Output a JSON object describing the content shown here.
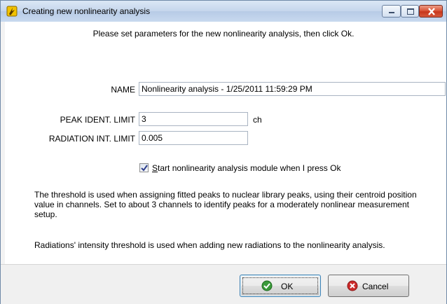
{
  "window": {
    "title": "Creating new nonlinearity analysis",
    "icon": "lightning-wrench-icon",
    "controls": {
      "minimize": "minimize-icon",
      "maximize": "maximize-icon",
      "close": "close-icon"
    }
  },
  "instructions": "Please set parameters for the new nonlinearity analysis, then click Ok.",
  "fields": {
    "name": {
      "label": "NAME",
      "value": "Nonlinearity analysis - 1/25/2011 11:59:29 PM"
    },
    "peak_ident_limit": {
      "label": "PEAK IDENT. LIMIT",
      "value": "3",
      "unit": "ch"
    },
    "radiation_int_limit": {
      "label": "RADIATION INT. LIMIT",
      "value": "0.005"
    }
  },
  "checkbox": {
    "label_prefix": "S",
    "label_rest": "tart nonlinearity analysis module when I press Ok",
    "checked": true
  },
  "help": {
    "threshold": "The threshold is used when assigning fitted peaks to nuclear library peaks, using their centroid position value in channels. Set to about 3 channels to identify peaks for a moderately nonlinear measurement setup.",
    "radiation": "Radiations' intensity threshold is used when adding new radiations to the nonlinearity analysis."
  },
  "buttons": {
    "ok": "OK",
    "cancel": "Cancel"
  },
  "colors": {
    "titlebar": "#c5d6ec",
    "close": "#c7371c",
    "ok_icon": "#3a9a3a",
    "cancel_icon": "#cc2a2a"
  }
}
